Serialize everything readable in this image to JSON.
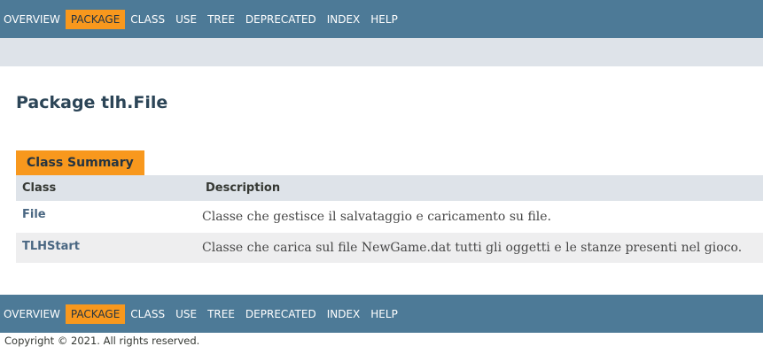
{
  "nav": {
    "items": [
      {
        "label": "OVERVIEW",
        "active": false
      },
      {
        "label": "PACKAGE",
        "active": true
      },
      {
        "label": "CLASS",
        "active": false
      },
      {
        "label": "USE",
        "active": false
      },
      {
        "label": "TREE",
        "active": false
      },
      {
        "label": "DEPRECATED",
        "active": false
      },
      {
        "label": "INDEX",
        "active": false
      },
      {
        "label": "HELP",
        "active": false
      }
    ]
  },
  "page": {
    "title": "Package tlh.File"
  },
  "summary": {
    "caption": "Class Summary",
    "columns": [
      "Class",
      "Description"
    ],
    "rows": [
      {
        "name": "File",
        "description": "Classe che gestisce il salvataggio e caricamento su file."
      },
      {
        "name": "TLHStart",
        "description": "Classe che carica sul file NewGame.dat tutti gli oggetti e le stanze presenti nel gioco."
      }
    ]
  },
  "footer": {
    "copyright": "Copyright © 2021. All rights reserved."
  },
  "colors": {
    "navbar": "#4d7a97",
    "active": "#f8981d",
    "subnav": "#dee3e9",
    "link": "#4a6782",
    "title": "#2c4557"
  }
}
